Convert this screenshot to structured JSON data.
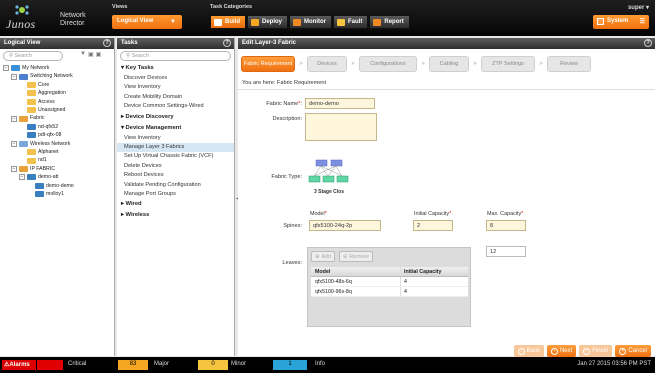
{
  "header": {
    "logo_word": "Junos",
    "app_name_line1": "Network",
    "app_name_line2": "Director",
    "views_label": "Views",
    "view_selected": "Logical View",
    "task_categories_label": "Task Categories",
    "task_buttons": [
      {
        "label": "Build",
        "icon": "build-icon",
        "color": "#ff9933"
      },
      {
        "label": "Deploy",
        "icon": "deploy-icon",
        "color": "#f5a623"
      },
      {
        "label": "Monitor",
        "icon": "monitor-icon",
        "color": "#f08a24"
      },
      {
        "label": "Fault",
        "icon": "fault-icon",
        "color": "#f5c542"
      },
      {
        "label": "Report",
        "icon": "report-icon",
        "color": "#f08a24"
      }
    ],
    "user": "super",
    "system_label": "System"
  },
  "logical_view": {
    "title": "Logical View",
    "search_placeholder": "Search",
    "tree": [
      {
        "label": "My Network",
        "depth": 0,
        "icon": "globe-icon"
      },
      {
        "label": "Switching Network",
        "depth": 1,
        "icon": "network-icon"
      },
      {
        "label": "Core",
        "depth": 2,
        "icon": "folder-icon"
      },
      {
        "label": "Aggregation",
        "depth": 2,
        "icon": "folder-icon"
      },
      {
        "label": "Access",
        "depth": 2,
        "icon": "folder-icon"
      },
      {
        "label": "Unassigned",
        "depth": 2,
        "icon": "folder-icon"
      },
      {
        "label": "Fabric",
        "depth": 1,
        "icon": "fabric-icon"
      },
      {
        "label": "nd-qfx52",
        "depth": 2,
        "icon": "switch-icon"
      },
      {
        "label": "pdt-qfx-08",
        "depth": 2,
        "icon": "switch-icon"
      },
      {
        "label": "Wireless Network",
        "depth": 1,
        "icon": "wireless-icon"
      },
      {
        "label": "Alphanet",
        "depth": 2,
        "icon": "folder-icon"
      },
      {
        "label": "nd1",
        "depth": 2,
        "icon": "folder-icon"
      },
      {
        "label": "IP FABRIC",
        "depth": 1,
        "icon": "fabric-icon"
      },
      {
        "label": "demo-att",
        "depth": 2,
        "icon": "switch-icon"
      },
      {
        "label": "demo-demo",
        "depth": 3,
        "icon": "switch-icon"
      },
      {
        "label": "molloy1",
        "depth": 3,
        "icon": "switch-icon"
      }
    ]
  },
  "tasks": {
    "title": "Tasks",
    "search_placeholder": "Search",
    "sections": [
      {
        "label": "Key Tasks",
        "items": [
          "Discover Devices",
          "View Inventory",
          "Create Mobility Domain",
          "Device Common Settings-Wired"
        ]
      },
      {
        "label": "Device Discovery",
        "collapsed": true,
        "items": []
      },
      {
        "label": "Device Management",
        "items": [
          "View Inventory",
          "Manage Layer 3 Fabrics",
          "Set Up Virtual Chassis Fabric (VCF)",
          "Delete Devices",
          "Reboot Devices",
          "Validate Pending Configuration",
          "Manage Port Groups"
        ]
      },
      {
        "label": "Wired",
        "collapsed": true,
        "items": []
      },
      {
        "label": "Wireless",
        "collapsed": true,
        "items": []
      }
    ],
    "selected_item": "Manage Layer 3 Fabrics"
  },
  "main": {
    "title": "Edit Layer-3 Fabric",
    "steps": [
      "Fabric Requirement",
      "Devices",
      "Configurations",
      "Cabling",
      "ZTP Settings",
      "Review"
    ],
    "current_step": "Fabric Requirement",
    "you_are_here": "You are here:  Fabric Requirement",
    "fabric_name_label": "Fabric Name",
    "fabric_name_value": "demo-demo",
    "description_label": "Description",
    "description_value": "",
    "fabric_type_label": "Fabric Type",
    "fabric_type_caption": "3 Stage Clos",
    "spines_label": "Spines",
    "model_col": "Model",
    "initial_capacity_col": "Initial Capacity",
    "max_capacity_col": "Max. Capacity",
    "spine_model": "qfx5100-24q-2p",
    "spine_initial": "2",
    "spine_max": "8",
    "leaves_label": "Leaves",
    "leaves_max": "12",
    "add_label": "Add",
    "remove_label": "Remove",
    "leaves_table": {
      "headers": [
        "Model",
        "Initial Capacity"
      ],
      "rows": [
        [
          "qfx5100-48s-6q",
          "4"
        ],
        [
          "qfx5100-96s-8q",
          "4"
        ]
      ]
    },
    "buttons": {
      "back": "Back",
      "next": "Next",
      "finish": "Finish",
      "cancel": "Cancel"
    }
  },
  "status_bar": {
    "alarms_label": "Alarms",
    "critical_count": "",
    "critical_label": "Critical",
    "major_count": "83",
    "major_label": "Major",
    "minor_count": "0",
    "minor_label": "Minor",
    "info_count": "1",
    "info_label": "Info",
    "timestamp": "Jan 27 2015 03:56 PM PST"
  },
  "colors": {
    "accent": "#f07010",
    "selected": "#d7e6f3",
    "critical": "#e00000",
    "major": "#f5a623",
    "info": "#2aa3d8"
  }
}
